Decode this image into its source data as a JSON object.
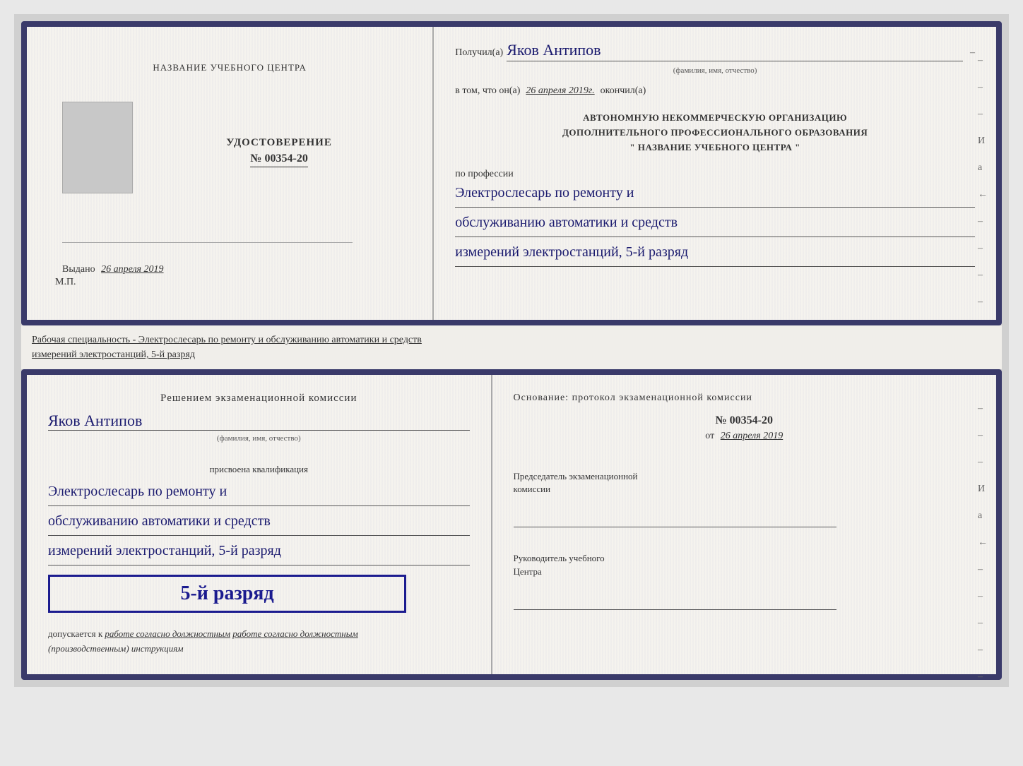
{
  "page": {
    "background": "#d0d0d0"
  },
  "top_document": {
    "left": {
      "center_title": "НАЗВАНИЕ УЧЕБНОГО ЦЕНТРА",
      "cert_title": "УДОСТОВЕРЕНИЕ",
      "cert_number_prefix": "№",
      "cert_number": "00354-20",
      "issued_label": "Выдано",
      "issued_date": "26 апреля 2019",
      "stamp_label": "М.П."
    },
    "right": {
      "received_label": "Получил(а)",
      "recipient_name": "Яков Антипов",
      "name_sub_label": "(фамилия, имя, отчество)",
      "date_prefix": "в том, что он(а)",
      "date_value": "26 апреля 2019г.",
      "date_suffix": "окончил(а)",
      "org_line1": "АВТОНОМНУЮ НЕКОММЕРЧЕСКУЮ ОРГАНИЗАЦИЮ",
      "org_line2": "ДОПОЛНИТЕЛЬНОГО ПРОФЕССИОНАЛЬНОГО ОБРАЗОВАНИЯ",
      "org_line3": "\"   НАЗВАНИЕ УЧЕБНОГО ЦЕНТРА   \"",
      "profession_prefix": "по профессии",
      "profession_line1": "Электрослесарь по ремонту и",
      "profession_line2": "обслуживанию автоматики и средств",
      "profession_line3": "измерений электростанций, 5-й разряд"
    }
  },
  "separator": {
    "text_line1": "Рабочая специальность - Электрослесарь по ремонту и обслуживанию автоматики и средств",
    "text_line2": "измерений электростанций, 5-й разряд"
  },
  "bottom_document": {
    "left": {
      "commission_title": "Решением экзаменационной комиссии",
      "person_name": "Яков Антипов",
      "name_sub_label": "(фамилия, имя, отчество)",
      "qualification_label": "присвоена квалификация",
      "qual_line1": "Электрослесарь по ремонту и",
      "qual_line2": "обслуживанию автоматики и средств",
      "qual_line3": "измерений электростанций, 5-й разряд",
      "rank_badge": "5-й разряд",
      "admission_prefix": "допускается к",
      "admission_text": "работе согласно должностным",
      "admission_text2": "(производственным) инструкциям"
    },
    "right": {
      "basis_title": "Основание: протокол экзаменационной комиссии",
      "protocol_number_prefix": "№",
      "protocol_number": "00354-20",
      "date_prefix": "от",
      "date_value": "26 апреля 2019",
      "chairman_title_line1": "Председатель экзаменационной",
      "chairman_title_line2": "комиссии",
      "director_title_line1": "Руководитель учебного",
      "director_title_line2": "Центра"
    }
  },
  "side_decorations": {
    "dashes": [
      "-",
      "-",
      "-",
      "И",
      "а",
      "←",
      "-",
      "-",
      "-",
      "-",
      "-"
    ]
  }
}
